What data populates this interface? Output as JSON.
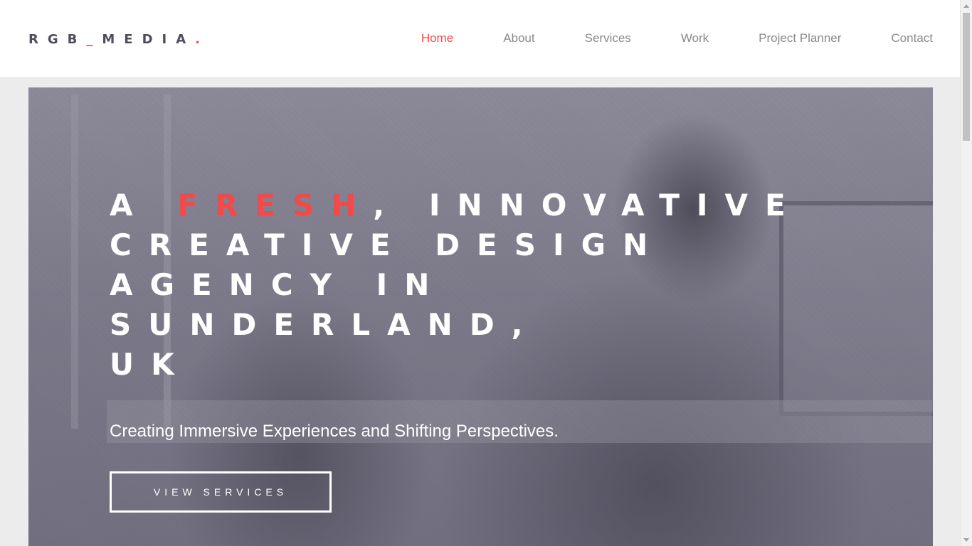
{
  "brand": {
    "logo_main": "RGB",
    "logo_sep": "_",
    "logo_tail": "MEDIA",
    "logo_dot": "."
  },
  "nav": {
    "items": [
      {
        "label": "Home",
        "active": true
      },
      {
        "label": "About",
        "active": false
      },
      {
        "label": "Services",
        "active": false
      },
      {
        "label": "Work",
        "active": false
      },
      {
        "label": "Project Planner",
        "active": false
      },
      {
        "label": "Contact",
        "active": false
      }
    ]
  },
  "hero": {
    "headline_pre": "A ",
    "headline_highlight": "FRESH",
    "headline_post_1": ", INNOVATIVE",
    "headline_line_2": "CREATIVE DESIGN",
    "headline_line_3": "AGENCY IN SUNDERLAND,",
    "headline_line_4": "UK",
    "subtitle": "Creating Immersive Experiences and Shifting Perspectives.",
    "cta_label": "VIEW SERVICES"
  },
  "colors": {
    "accent": "#f04a4a",
    "text_gray": "#8a8a8a",
    "logo_gray": "#4e4d5c",
    "hero_overlay": "#7e7c8b"
  },
  "icons": {
    "scroll_up": "chevron-up-icon",
    "scroll_down": "chevron-down-icon"
  }
}
